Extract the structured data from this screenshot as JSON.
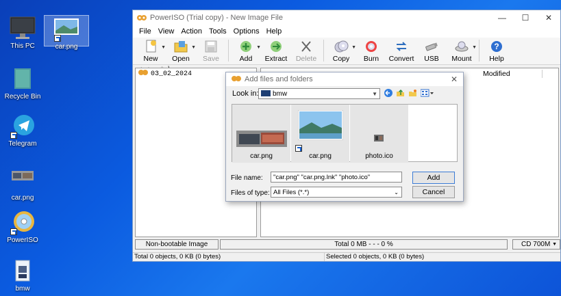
{
  "desktop": {
    "top_labels": [
      "",
      ""
    ],
    "icons": [
      {
        "label": "This PC"
      },
      {
        "label": "car.png"
      },
      {
        "label": "Recycle Bin"
      },
      {
        "label": "Telegram"
      },
      {
        "label": "car.png"
      },
      {
        "label": "PowerISO"
      },
      {
        "label": "bmw"
      }
    ]
  },
  "window": {
    "title": "PowerISO (Trial copy) - New Image File",
    "menu": [
      "File",
      "View",
      "Action",
      "Tools",
      "Options",
      "Help"
    ],
    "toolbar": [
      {
        "label": "New",
        "icon": "new-file-icon"
      },
      {
        "label": "Open",
        "icon": "open-folder-icon"
      },
      {
        "label": "Save",
        "icon": "save-disk-icon"
      },
      {
        "label": "Add",
        "icon": "add-icon"
      },
      {
        "label": "Extract",
        "icon": "extract-icon"
      },
      {
        "label": "Delete",
        "icon": "delete-icon"
      },
      {
        "label": "Copy",
        "icon": "copy-disc-icon"
      },
      {
        "label": "Burn",
        "icon": "burn-icon"
      },
      {
        "label": "Convert",
        "icon": "convert-icon"
      },
      {
        "label": "USB",
        "icon": "usb-icon"
      },
      {
        "label": "Mount",
        "icon": "mount-icon"
      },
      {
        "label": "Help",
        "icon": "help-icon"
      }
    ],
    "address_path": "\\",
    "tree_root": "03_02_2024",
    "column_modified": "Modified",
    "status": {
      "bootable": "Non-bootable Image",
      "total": "Total  0 MB   - - -  0 %",
      "media": "CD 700M",
      "objects_total": "Total 0 objects, 0 KB (0 bytes)",
      "objects_selected": "Selected 0 objects, 0 KB (0 bytes)"
    }
  },
  "dialog": {
    "title": "Add files and folders",
    "look_in_label": "Look in:",
    "look_in_value": "bmw",
    "files": [
      {
        "name": "car.png"
      },
      {
        "name": "car.png"
      },
      {
        "name": "photo.ico"
      }
    ],
    "file_name_label": "File name:",
    "file_name_value": "\"car.png\" \"car.png.lnk\" \"photo.ico\"",
    "files_of_type_label": "Files of type:",
    "files_of_type_value": "All Files (*.*)",
    "add_label": "Add",
    "cancel_label": "Cancel"
  },
  "colors": {
    "accent": "#0a5ad6",
    "title_text": "#6b6b6b"
  }
}
